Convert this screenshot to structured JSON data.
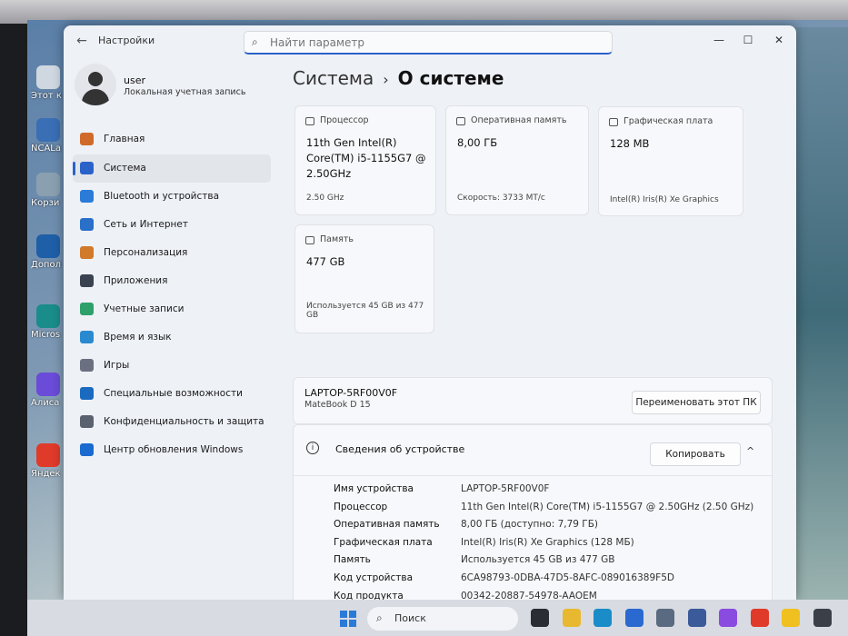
{
  "desktop": {
    "icons": [
      {
        "label": "Этот компь",
        "color": "#cfd8e0"
      },
      {
        "label": "NCALa",
        "color": "#3a6fb5"
      },
      {
        "label": "Корзи",
        "color": "#8aa0b0"
      },
      {
        "label": "Дополн сведени",
        "color": "#1f5fa8"
      },
      {
        "label": "Micros Edge",
        "color": "#1a8c8a"
      },
      {
        "label": "Алиса",
        "color": "#6a4cd8"
      },
      {
        "label": "Яндек Браузе",
        "color": "#e03a2a"
      }
    ]
  },
  "window": {
    "app_title": "Настройки",
    "search_placeholder": "Найти параметр",
    "controls": {
      "minimize": "—",
      "maximize": "☐",
      "close": "✕"
    }
  },
  "user": {
    "name": "user",
    "account_type": "Локальная учетная запись"
  },
  "sidebar": {
    "items": [
      {
        "label": "Главная",
        "icon": "home-icon",
        "color": "#d06a2a",
        "active": false
      },
      {
        "label": "Система",
        "icon": "monitor-icon",
        "color": "#2b62c9",
        "active": true
      },
      {
        "label": "Bluetooth и устройства",
        "icon": "bluetooth-icon",
        "color": "#2b7bd8",
        "active": false
      },
      {
        "label": "Сеть и Интернет",
        "icon": "wifi-icon",
        "color": "#2a6fc8",
        "active": false
      },
      {
        "label": "Персонализация",
        "icon": "brush-icon",
        "color": "#d07a2a",
        "active": false
      },
      {
        "label": "Приложения",
        "icon": "apps-icon",
        "color": "#3a4250",
        "active": false
      },
      {
        "label": "Учетные записи",
        "icon": "person-icon",
        "color": "#2ea06a",
        "active": false
      },
      {
        "label": "Время и язык",
        "icon": "globe-clock-icon",
        "color": "#2a8ad0",
        "active": false
      },
      {
        "label": "Игры",
        "icon": "gamepad-icon",
        "color": "#6a7080",
        "active": false
      },
      {
        "label": "Специальные возможности",
        "icon": "accessibility-icon",
        "color": "#1a6ac0",
        "active": false
      },
      {
        "label": "Конфиденциальность и защита",
        "icon": "shield-icon",
        "color": "#5a6270",
        "active": false
      },
      {
        "label": "Центр обновления Windows",
        "icon": "update-icon",
        "color": "#1a6ad0",
        "active": false
      }
    ]
  },
  "breadcrumb": {
    "parent": "Система",
    "separator": "›",
    "current": "О системе"
  },
  "cards": {
    "cpu": {
      "title": "Процессор",
      "value": "11th Gen Intel(R) Core(TM) i5-1155G7 @ 2.50GHz",
      "sub": "2.50 GHz"
    },
    "ram": {
      "title": "Оперативная память",
      "value": "8,00 ГБ",
      "sub": "Скорость: 3733 MT/с"
    },
    "gpu": {
      "title": "Графическая плата",
      "value": "128 MB",
      "sub": "Intel(R) Iris(R) Xe Graphics"
    },
    "storage": {
      "title": "Память",
      "value": "477 GB",
      "sub": "Используется 45 GB из 477 GB"
    }
  },
  "device": {
    "name": "LAPTOP-5RF00V0F",
    "model": "MateBook D 15",
    "rename_button": "Переименовать этот ПК"
  },
  "specs": {
    "title": "Сведения об устройстве",
    "copy_button": "Копировать",
    "collapse_icon": "^",
    "rows": [
      {
        "key": "Имя устройства",
        "value": "LAPTOP-5RF00V0F"
      },
      {
        "key": "Процессор",
        "value": "11th Gen Intel(R) Core(TM) i5-1155G7 @ 2.50GHz (2.50 GHz)"
      },
      {
        "key": "Оперативная память",
        "value": "8,00 ГБ (доступно: 7,79 ГБ)"
      },
      {
        "key": "Графическая плата",
        "value": "Intel(R) Iris(R) Xe Graphics (128 МБ)"
      },
      {
        "key": "Память",
        "value": "Используется 45 GB из 477 GB"
      },
      {
        "key": "Код устройства",
        "value": "6CA98793-0DBA-47D5-8AFC-089016389F5D"
      },
      {
        "key": "Код продукта",
        "value": "00342-20887-54978-AAOEM"
      }
    ]
  },
  "taskbar": {
    "search_label": "Поиск",
    "icons": [
      {
        "name": "task-view-icon",
        "color": "#2a2d33"
      },
      {
        "name": "file-explorer-icon",
        "color": "#e8b830"
      },
      {
        "name": "edge-icon",
        "color": "#1a8cc8"
      },
      {
        "name": "store-icon",
        "color": "#2a6ad0"
      },
      {
        "name": "app-icon",
        "color": "#5a6a80"
      },
      {
        "name": "photos-icon",
        "color": "#3a5a9a"
      },
      {
        "name": "alice-icon",
        "color": "#8a4ce0"
      },
      {
        "name": "yandex-icon",
        "color": "#e03a2a"
      },
      {
        "name": "yandex-browser-icon",
        "color": "#f0c020"
      },
      {
        "name": "settings-icon",
        "color": "#3a3f48"
      }
    ]
  }
}
